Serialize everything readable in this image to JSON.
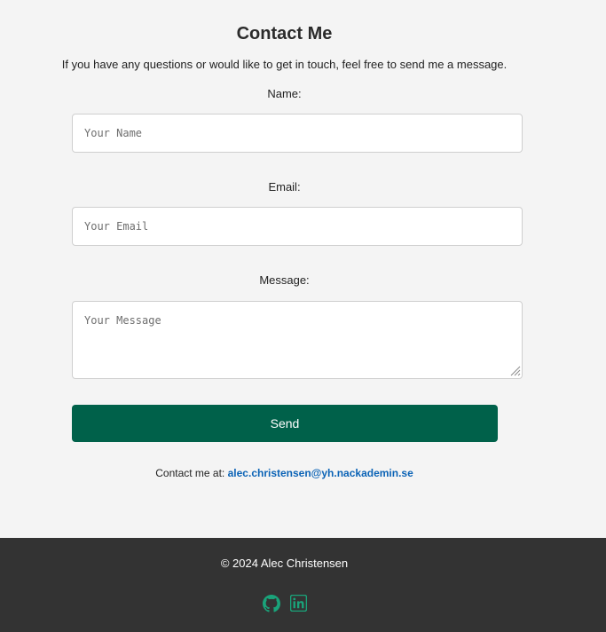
{
  "contact": {
    "title": "Contact Me",
    "intro": "If you have any questions or would like to get in touch, feel free to send me a message.",
    "name_label": "Name:",
    "name_placeholder": "Your Name",
    "email_label": "Email:",
    "email_placeholder": "Your Email",
    "message_label": "Message:",
    "message_placeholder": "Your Message",
    "send_label": "Send",
    "contact_prefix": "Contact me at:",
    "contact_email": "alec.christensen@yh.nackademin.se"
  },
  "footer": {
    "copyright": "© 2024 Alec Christensen",
    "icons": [
      "github-icon",
      "linkedin-icon"
    ]
  },
  "colors": {
    "accent": "#00614a",
    "icon": "#1aa37a",
    "link": "#0b63b6",
    "footer_bg": "#333333",
    "page_bg": "#f4f4f4"
  }
}
